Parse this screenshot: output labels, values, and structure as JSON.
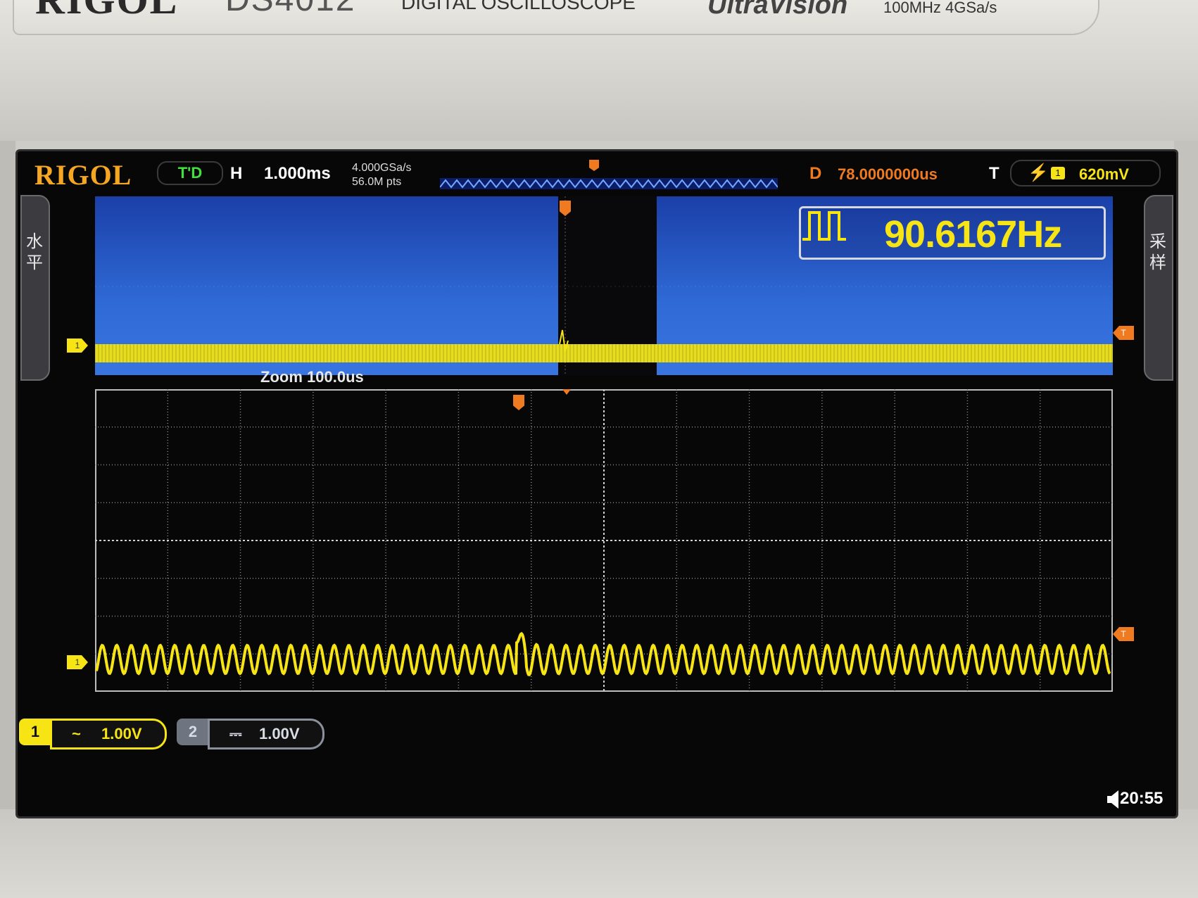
{
  "nameplate": {
    "brand": "RIGOL",
    "model": "DS4012",
    "description": "DIGITAL OSCILLOSCOPE",
    "series": "UltraVision",
    "spec": "100MHz 4GSa/s"
  },
  "header": {
    "brand": "RIGOL",
    "trigger_status": "T'D",
    "horizontal_label": "H",
    "timebase": "1.000ms",
    "sample_rate": "4.000GSa/s",
    "memory_depth": "56.0M pts",
    "delay_label": "D",
    "delay_value": "78.0000000us",
    "trigger_label": "T",
    "trigger_source": "1",
    "trigger_level": "620mV"
  },
  "side_tabs": {
    "left": "水平",
    "right": "采样"
  },
  "measurement": {
    "frequency": "90.6167Hz"
  },
  "zoom": {
    "label": "Zoom",
    "timebase": "100.0us"
  },
  "channels": [
    {
      "number": "1",
      "coupling_icon": "~",
      "scale": "1.00V",
      "color": "#f7e414"
    },
    {
      "number": "2",
      "coupling_icon": "⎓",
      "scale": "1.00V",
      "color": "#a9b0c0"
    }
  ],
  "status": {
    "time": "20:55"
  },
  "markers": {
    "channel1": "1",
    "trigger": "T"
  },
  "colors": {
    "channel1": "#f7e414",
    "trigger": "#f07a20",
    "delay": "#f07a20",
    "overview_background": "#2f6ad6",
    "brand": "#f5a623",
    "trigger_status": "#3fe03f"
  }
}
